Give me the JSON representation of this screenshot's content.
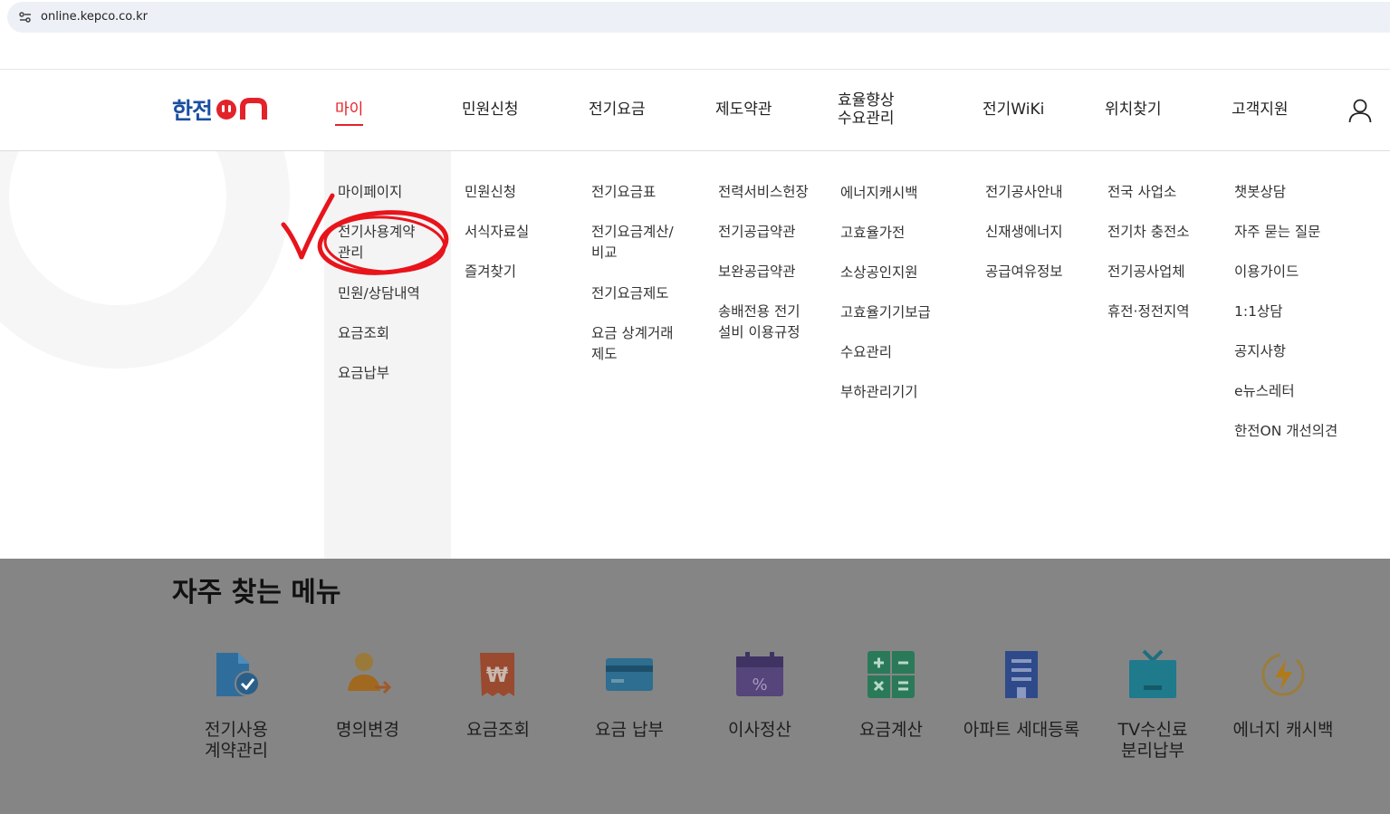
{
  "browser": {
    "url": "online.kepco.co.kr"
  },
  "logo": {
    "text_part": "한전",
    "on_part": "ON"
  },
  "nav": [
    {
      "label": "마이",
      "active": true
    },
    {
      "label": "민원신청"
    },
    {
      "label": "전기요금"
    },
    {
      "label": "제도약관"
    },
    {
      "label": "효율향상\n수요관리"
    },
    {
      "label": "전기WiKi"
    },
    {
      "label": "위치찾기"
    },
    {
      "label": "고객지원"
    }
  ],
  "menus": [
    {
      "items": [
        "마이페이지",
        "전기사용계약\n관리",
        "민원/상담내역",
        "요금조회",
        "요금납부"
      ]
    },
    {
      "items": [
        "민원신청",
        "서식자료실",
        "즐겨찾기"
      ]
    },
    {
      "items": [
        "전기요금표",
        "전기요금계산/\n비교",
        "전기요금제도",
        "요금 상계거래\n제도"
      ]
    },
    {
      "items": [
        "전력서비스헌장",
        "전기공급약관",
        "보완공급약관",
        "송배전용 전기\n설비 이용규정"
      ]
    },
    {
      "items": [
        "에너지캐시백",
        "고효율가전",
        "소상공인지원",
        "고효율기기보급",
        "수요관리",
        "부하관리기기"
      ]
    },
    {
      "items": [
        "전기공사안내",
        "신재생에너지",
        "공급여유정보"
      ]
    },
    {
      "items": [
        "전국 사업소",
        "전기차 충전소",
        "전기공사업체",
        "휴전·정전지역"
      ]
    },
    {
      "items": [
        "챗봇상담",
        "자주 묻는 질문",
        "이용가이드",
        "1:1상담",
        "공지사항",
        "e뉴스레터",
        "한전ON 개선의견"
      ]
    }
  ],
  "frequent": {
    "title": "자주 찾는 메뉴",
    "items": [
      {
        "label": "전기사용\n계약관리",
        "icon": "contract-doc-icon"
      },
      {
        "label": "명의변경",
        "icon": "person-transfer-icon"
      },
      {
        "label": "요금조회",
        "icon": "won-receipt-icon"
      },
      {
        "label": "요금 납부",
        "icon": "card-icon"
      },
      {
        "label": "이사정산",
        "icon": "calendar-percent-icon"
      },
      {
        "label": "요금계산",
        "icon": "calculator-icon"
      },
      {
        "label": "아파트 세대등록",
        "icon": "apartment-icon"
      },
      {
        "label": "TV수신료\n분리납부",
        "icon": "tv-icon"
      },
      {
        "label": "에너지 캐시백",
        "icon": "energy-bolt-icon"
      }
    ]
  },
  "colors": {
    "accent": "#e3222a",
    "brand_blue": "#1a4fa0",
    "overlay": "#858585"
  }
}
